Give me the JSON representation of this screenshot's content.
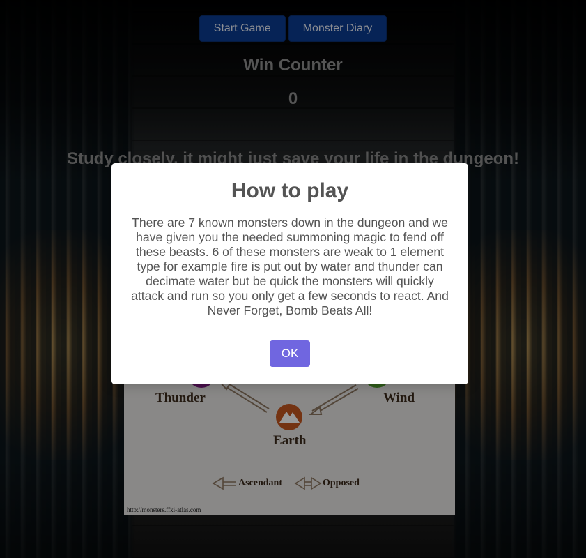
{
  "nav": {
    "start_label": "Start Game",
    "diary_label": "Monster Diary"
  },
  "win_counter": {
    "title": "Win Counter",
    "count": "0"
  },
  "study_text": "Study closely, it might just save your life in the dungeon!",
  "diagram": {
    "labels": {
      "thunder": "Thunder",
      "wind": "Wind",
      "earth": "Earth",
      "ascendant": "Ascendant",
      "opposed": "Opposed"
    },
    "source_url": "http://monsters.ffxi-atlas.com",
    "colors": {
      "thunder": "#7a1a7f",
      "wind": "#4f9a2c",
      "earth": "#c2551f"
    },
    "icons": [
      "thunder-element-icon",
      "wind-element-icon",
      "earth-element-icon",
      "ascendant-arrow-icon",
      "opposed-arrow-icon"
    ]
  },
  "modal": {
    "title": "How to play",
    "text": "There are 7 known monsters down in the dungeon and we have given you the needed summoning magic to fend off these beasts. 6 of these monsters are weak to 1 element type for example fire is put out by water and thunder can decimate water but be quick the monsters will quickly attack and run so you only get a few seconds to react. And Never Forget, Bomb Beats All!",
    "ok_label": "OK"
  },
  "colors": {
    "nav_button": "#0b3b8f",
    "ok_button": "#7066e0",
    "modal_text": "#545454"
  }
}
